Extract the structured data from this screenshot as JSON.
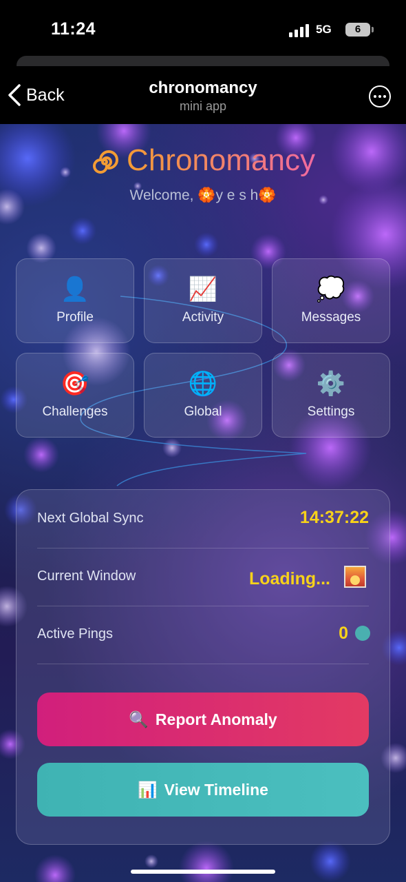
{
  "status_bar": {
    "time": "11:24",
    "network": "5G",
    "battery": "6"
  },
  "nav": {
    "back_label": "Back",
    "title": "chronomancy",
    "subtitle": "mini app"
  },
  "header": {
    "app_name": "Chronomancy",
    "welcome_prefix": "Welcome, ",
    "user_name": "y e s h"
  },
  "tiles": [
    {
      "label": "Profile",
      "icon": "person-icon",
      "glyph": "👤"
    },
    {
      "label": "Activity",
      "icon": "chart-up-icon",
      "glyph": "📈"
    },
    {
      "label": "Messages",
      "icon": "thought-bubble-icon",
      "glyph": "💭"
    },
    {
      "label": "Challenges",
      "icon": "target-icon",
      "glyph": "🎯"
    },
    {
      "label": "Global",
      "icon": "globe-icon",
      "glyph": "🌐"
    },
    {
      "label": "Settings",
      "icon": "gear-icon",
      "glyph": "⚙️"
    }
  ],
  "status_panel": {
    "next_sync_label": "Next Global Sync",
    "next_sync_value": "14:37:22",
    "current_window_label": "Current Window",
    "current_window_value": "Loading...",
    "active_pings_label": "Active Pings",
    "active_pings_value": "0"
  },
  "actions": {
    "report_label": "Report Anomaly",
    "report_icon": "🔍",
    "timeline_label": "View Timeline",
    "timeline_icon": "📊"
  },
  "colors": {
    "accent_yellow": "#f7d21a",
    "report_button": "#d11f7c",
    "timeline_button": "#3fb3b3"
  }
}
